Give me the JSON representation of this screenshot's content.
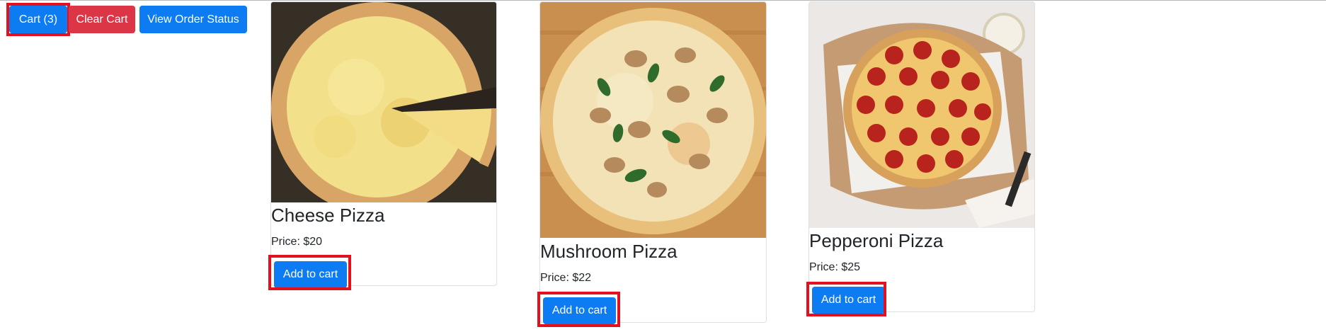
{
  "toolbar": {
    "cart_label": "Cart (3)",
    "clear_cart_label": "Clear Cart",
    "view_order_status_label": "View Order Status"
  },
  "products": [
    {
      "name": "Cheese Pizza",
      "price": "Price: $20",
      "add_label": "Add to cart",
      "image": "cheese-pizza-photo"
    },
    {
      "name": "Mushroom Pizza",
      "price": "Price: $22",
      "add_label": "Add to cart",
      "image": "mushroom-pizza-photo"
    },
    {
      "name": "Pepperoni Pizza",
      "price": "Price: $25",
      "add_label": "Add to cart",
      "image": "pepperoni-pizza-photo"
    }
  ],
  "colors": {
    "primary": "#0d7cf2",
    "danger": "#dc3545",
    "highlight": "#e3111d"
  }
}
